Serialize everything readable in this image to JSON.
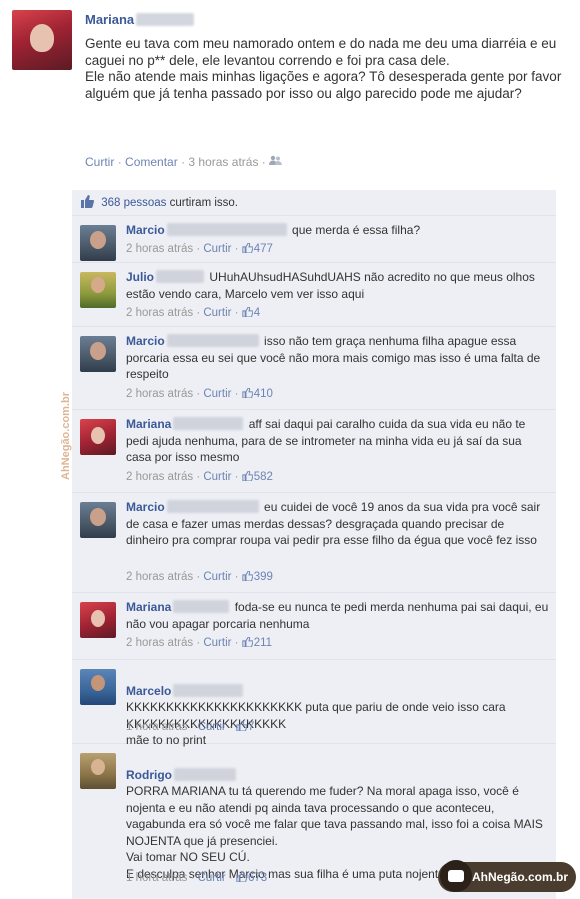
{
  "post": {
    "author": "Mariana",
    "text": "Gente eu tava com meu namorado ontem e do nada me deu uma diarréia e eu caguei no p** dele, ele levantou correndo e foi pra casa dele.\nEle não atende mais minhas ligações e agora? Tô desesperada gente por favor alguém que já tenha passado por isso ou algo parecido pode me ajudar?",
    "meta": {
      "like": "Curtir",
      "comment": "Comentar",
      "time": "3 horas atrás"
    }
  },
  "likes": {
    "count_text": "368 pessoas",
    "suffix": "curtiram isso."
  },
  "comments": [
    {
      "name": "Marcio",
      "text": "que merda é essa filha?",
      "time": "2 horas atrás",
      "like": "Curtir",
      "likes": "477"
    },
    {
      "name": "Julio",
      "text": "UHuhAUhsudHASuhdUAHS não acredito no que meus olhos estão vendo cara, Marcelo vem ver isso aqui",
      "time": "2 horas atrás",
      "like": "Curtir",
      "likes": "4"
    },
    {
      "name": "Marcio",
      "text": "isso não tem graça nenhuma filha apague essa porcaria essa eu sei que você não mora mais comigo mas isso é uma falta de respeito",
      "time": "2 horas atrás",
      "like": "Curtir",
      "likes": "410"
    },
    {
      "name": "Mariana",
      "text": "aff sai daqui pai caralho cuida da sua vida eu não te pedi ajuda nenhuma, para de se intrometer na minha vida eu já saí da sua casa por isso mesmo",
      "time": "2 horas atrás",
      "like": "Curtir",
      "likes": "582"
    },
    {
      "name": "Marcio",
      "text": "eu cuidei de você 19 anos da sua vida pra você sair de casa e fazer umas merdas dessas? desgraçada quando precisar de dinheiro pra comprar roupa vai pedir pra esse filho da égua que você fez isso",
      "time": "2 horas atrás",
      "like": "Curtir",
      "likes": "399"
    },
    {
      "name": "Mariana",
      "text": "foda-se eu nunca te pedi merda nenhuma pai sai daqui, eu não vou apagar porcaria nenhuma",
      "time": "2 horas atrás",
      "like": "Curtir",
      "likes": "211"
    },
    {
      "name": "Marcelo",
      "text": "KKKKKKKKKKKKKKKKKKKKKK puta que pariu de onde veio isso cara KKKKKKKKKKKKKKKKKKKK\nmãe to no print",
      "time": "1 hora atrás",
      "like": "Curtir",
      "likes": "7"
    },
    {
      "name": "Rodrigo",
      "text": "PORRA MARIANA tu tá querendo me fuder? Na moral apaga isso, você é nojenta e eu não atendi pq ainda tava processando o que aconteceu, vagabunda era só você me falar que tava passando mal, isso foi a coisa MAIS NOJENTA que já presenciei.\nVai tomar NO SEU CÚ.\nE desculpa senhor Marcio mas sua filha é uma puta nojenta, tomar no cu viu.",
      "time": "1 hora atrás",
      "like": "Curtir",
      "likes": "673"
    }
  ],
  "watermarks": {
    "vertical": "AhNegão.com.br",
    "badge": "AhNegão.com.br"
  },
  "colors": {
    "link": "#3b5998",
    "meta_link": "#6d84b4",
    "block_bg": "#edeff4"
  }
}
